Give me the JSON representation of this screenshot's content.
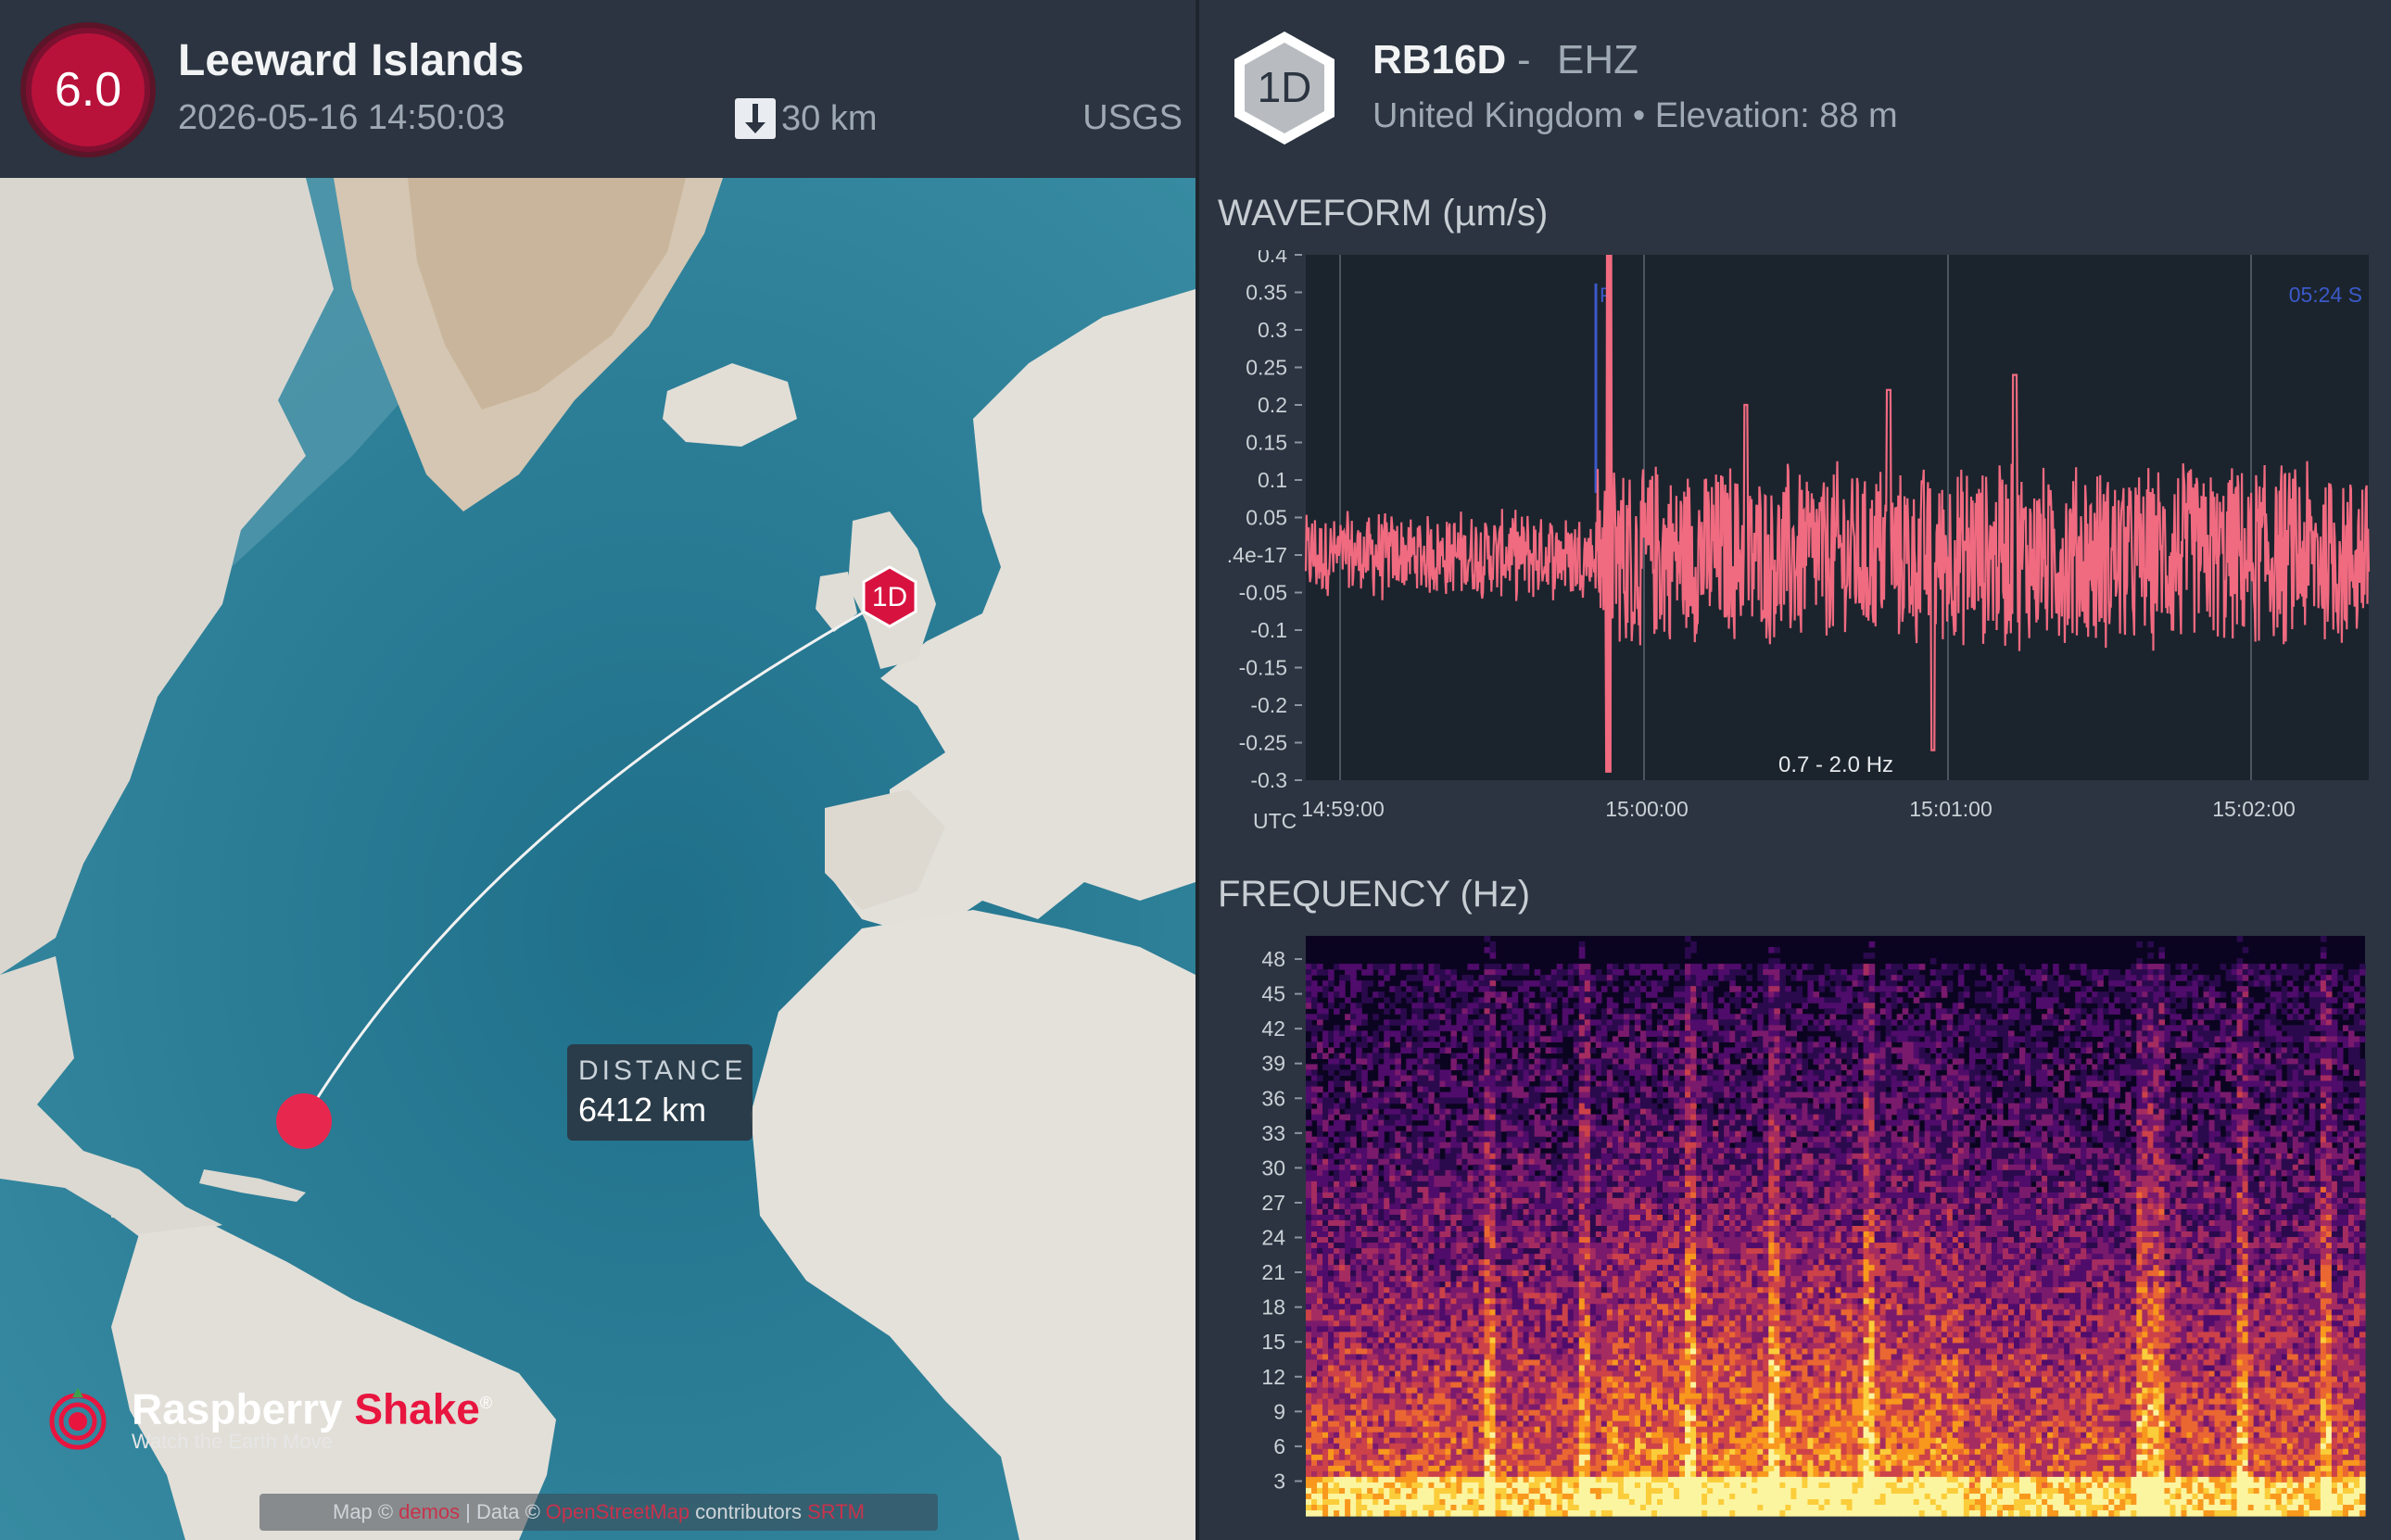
{
  "event": {
    "magnitude": "6.0",
    "region": "Leeward Islands",
    "datetime": "2026-05-16 14:50:03",
    "depth": "30 km",
    "source": "USGS"
  },
  "map": {
    "station_marker": "1D",
    "distance_label": "DISTANCE",
    "distance_value": "6412 km",
    "logo": {
      "name_part1": "Raspberry",
      "name_part2": "Shake",
      "reg": "®",
      "tagline": "Watch the Earth Move"
    },
    "attribution": {
      "prefix": "Map ©",
      "map_link": "demos",
      "data_prefix": "| Data ©",
      "osm_link": "OpenStreetMap",
      "contributors": "contributors",
      "srtm_link": "SRTM"
    }
  },
  "station": {
    "badge": "1D",
    "code": "RB16D",
    "separator": "-",
    "channel": "EHZ",
    "location": "United Kingdom • Elevation: 88 m"
  },
  "waveform": {
    "title": "WAVEFORM (µm/s)",
    "timezone": "UTC",
    "p_marker": "P",
    "s_marker": "05:24  S",
    "filter": "0.7 - 2.0 Hz",
    "line_color": "#f06a80",
    "y_ticks": [
      "0.4",
      "0.35",
      "0.3",
      "0.25",
      "0.2",
      "0.15",
      "0.1",
      "0.05",
      ".4e-17",
      "-0.05",
      "-0.1",
      "-0.15",
      "-0.2",
      "-0.25",
      "-0.3"
    ],
    "x_ticks": [
      "14:59:00",
      "15:00:00",
      "15:01:00",
      "15:02:00"
    ]
  },
  "frequency": {
    "title": "FREQUENCY (Hz)",
    "y_ticks": [
      "48",
      "45",
      "42",
      "39",
      "36",
      "33",
      "30",
      "27",
      "24",
      "21",
      "18",
      "15",
      "12",
      "9",
      "6",
      "3"
    ]
  },
  "chart_data": [
    {
      "type": "line",
      "title": "WAVEFORM (µm/s)",
      "ylabel": "µm/s",
      "xlabel": "UTC",
      "ylim": [
        -0.3,
        0.4
      ],
      "x_categories": [
        "14:59:00",
        "15:00:00",
        "15:01:00",
        "15:02:00"
      ],
      "series": [
        {
          "name": "",
          "description_values": {
            "baseline_amplitude": 0.05,
            "p_arrival": "14:59:51",
            "peak": 0.4,
            "trough": -0.3,
            "coda_amplitude": 0.1
          }
        }
      ]
    },
    {
      "type": "heatmap",
      "title": "FREQUENCY (Hz)",
      "ylim": [
        0,
        50
      ],
      "x_range": [
        "14:58:53",
        "15:02:25"
      ]
    }
  ]
}
